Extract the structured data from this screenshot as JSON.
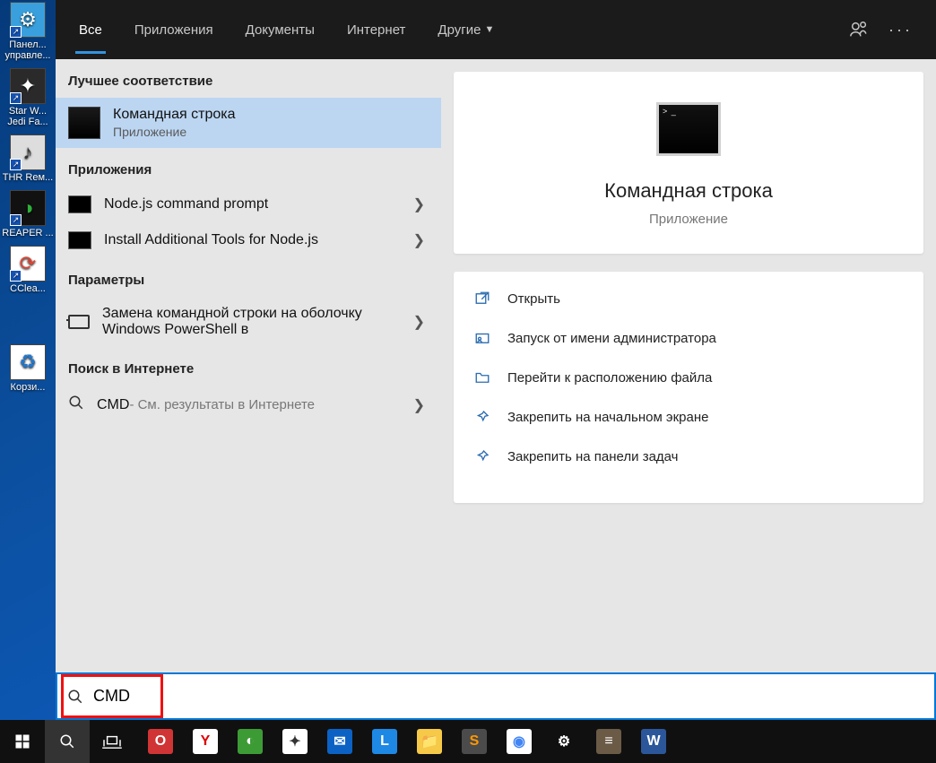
{
  "desktop": {
    "icons": [
      {
        "label": "Панел... управле..."
      },
      {
        "label": "Star W... Jedi Fa..."
      },
      {
        "label": "THR Rем..."
      },
      {
        "label": "REAPER ..."
      },
      {
        "label": "CClea..."
      },
      {
        "label": "Корзи..."
      }
    ]
  },
  "search": {
    "tabs": {
      "all": "Все",
      "apps": "Приложения",
      "docs": "Документы",
      "web": "Интернет",
      "more": "Другие"
    },
    "sections": {
      "best": "Лучшее соответствие",
      "apps": "Приложения",
      "settings": "Параметры",
      "web": "Поиск в Интернете"
    },
    "best": {
      "title": "Командная строка",
      "subtitle": "Приложение"
    },
    "app_results": [
      {
        "label": "Node.js command prompt"
      },
      {
        "label": "Install Additional Tools for Node.js"
      }
    ],
    "settings_results": [
      {
        "label": "Замена командной строки на оболочку Windows PowerShell в"
      }
    ],
    "web_results": {
      "query": "CMD",
      "suffix": " - См. результаты в Интернете"
    },
    "preview": {
      "title": "Командная строка",
      "subtitle": "Приложение",
      "actions": {
        "open": "Открыть",
        "runas": "Запуск от имени администратора",
        "location": "Перейти к расположению файла",
        "pin_start": "Закрепить на начальном экране",
        "pin_taskbar": "Закрепить на панели задач"
      }
    },
    "input": "CMD"
  },
  "taskbar": {
    "apps": [
      {
        "name": "opera",
        "bg": "#d13434",
        "txt": "O"
      },
      {
        "name": "yandex",
        "bg": "#ffffff",
        "txt": "Y",
        "fg": "#d00"
      },
      {
        "name": "tor",
        "bg": "#3d9b35",
        "txt": "◐"
      },
      {
        "name": "punto",
        "bg": "#ffffff",
        "txt": "✦",
        "fg": "#333"
      },
      {
        "name": "mail",
        "bg": "#0b62c4",
        "txt": "✉"
      },
      {
        "name": "L",
        "bg": "#1e88e5",
        "txt": "L"
      },
      {
        "name": "explorer",
        "bg": "#f7c948",
        "txt": "📁"
      },
      {
        "name": "sublime",
        "bg": "#4b4b4b",
        "txt": "S",
        "fg": "#ff9800"
      },
      {
        "name": "chrome",
        "bg": "#ffffff",
        "txt": "◉",
        "fg": "#4285F4"
      },
      {
        "name": "settings",
        "bg": "#101010",
        "txt": "⚙"
      },
      {
        "name": "studio",
        "bg": "#6b5a46",
        "txt": "≡"
      },
      {
        "name": "word",
        "bg": "#2b579a",
        "txt": "W"
      }
    ]
  }
}
